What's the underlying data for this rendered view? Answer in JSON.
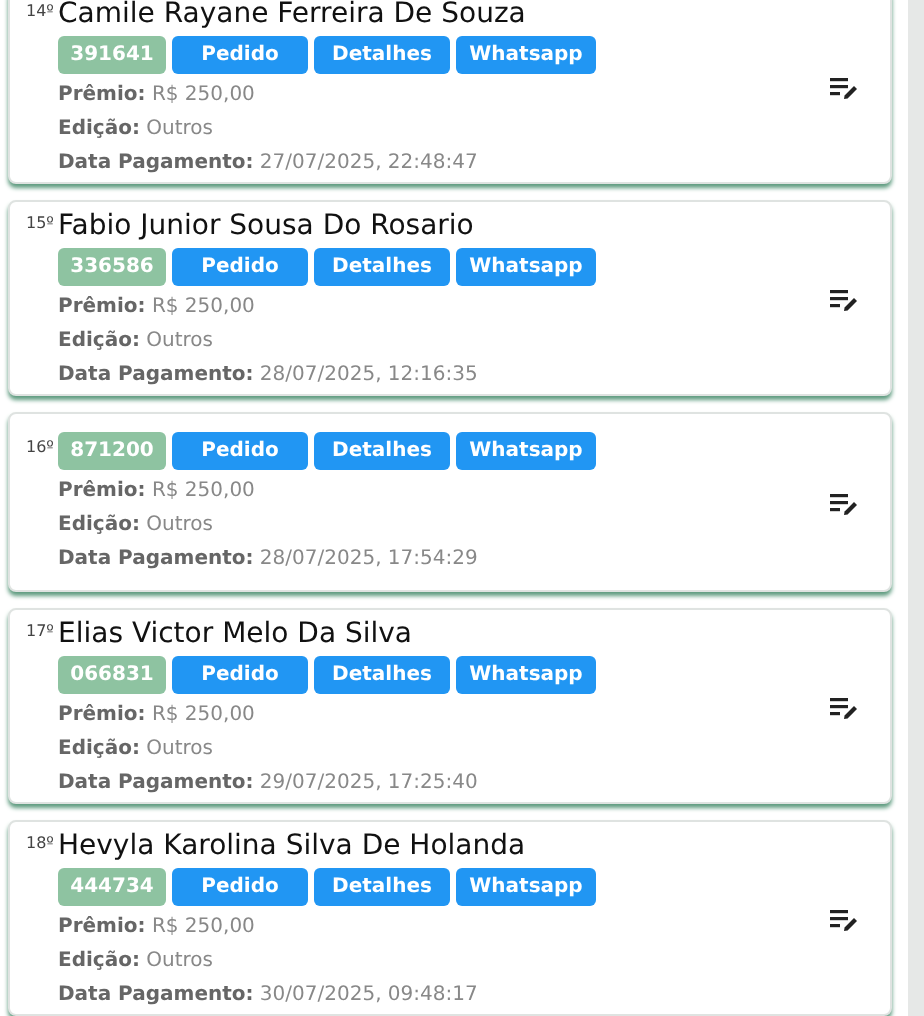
{
  "entries": [
    {
      "rank": "14º",
      "name": "Camile Rayane Ferreira De Souza",
      "code": "391641",
      "buttons": [
        "Pedido",
        "Detalhes",
        "Whatsapp"
      ],
      "fields": [
        {
          "label": "Prêmio:",
          "value": "R$ 250,00"
        },
        {
          "label": "Edição:",
          "value": "Outros"
        },
        {
          "label": "Data Pagamento:",
          "value": "27/07/2025, 22:48:47"
        }
      ]
    },
    {
      "rank": "15º",
      "name": "Fabio Junior Sousa Do Rosario",
      "code": "336586",
      "buttons": [
        "Pedido",
        "Detalhes",
        "Whatsapp"
      ],
      "fields": [
        {
          "label": "Prêmio:",
          "value": "R$ 250,00"
        },
        {
          "label": "Edição:",
          "value": "Outros"
        },
        {
          "label": "Data Pagamento:",
          "value": "28/07/2025, 12:16:35"
        }
      ]
    },
    {
      "rank": "16º",
      "code": "871200",
      "buttons": [
        "Pedido",
        "Detalhes",
        "Whatsapp"
      ],
      "fields": [
        {
          "label": "Prêmio:",
          "value": "R$ 250,00"
        },
        {
          "label": "Edição:",
          "value": "Outros"
        },
        {
          "label": "Data Pagamento:",
          "value": "28/07/2025, 17:54:29"
        }
      ]
    },
    {
      "rank": "17º",
      "name": "Elias Victor Melo Da Silva",
      "code": "066831",
      "buttons": [
        "Pedido",
        "Detalhes",
        "Whatsapp"
      ],
      "fields": [
        {
          "label": "Prêmio:",
          "value": "R$ 250,00"
        },
        {
          "label": "Edição:",
          "value": "Outros"
        },
        {
          "label": "Data Pagamento:",
          "value": "29/07/2025, 17:25:40"
        }
      ]
    },
    {
      "rank": "18º",
      "name": "Hevyla Karolina Silva De Holanda",
      "code": "444734",
      "buttons": [
        "Pedido",
        "Detalhes",
        "Whatsapp"
      ],
      "fields": [
        {
          "label": "Prêmio:",
          "value": "R$ 250,00"
        },
        {
          "label": "Edição:",
          "value": "Outros"
        },
        {
          "label": "Data Pagamento:",
          "value": "30/07/2025, 09:48:17"
        }
      ]
    }
  ]
}
